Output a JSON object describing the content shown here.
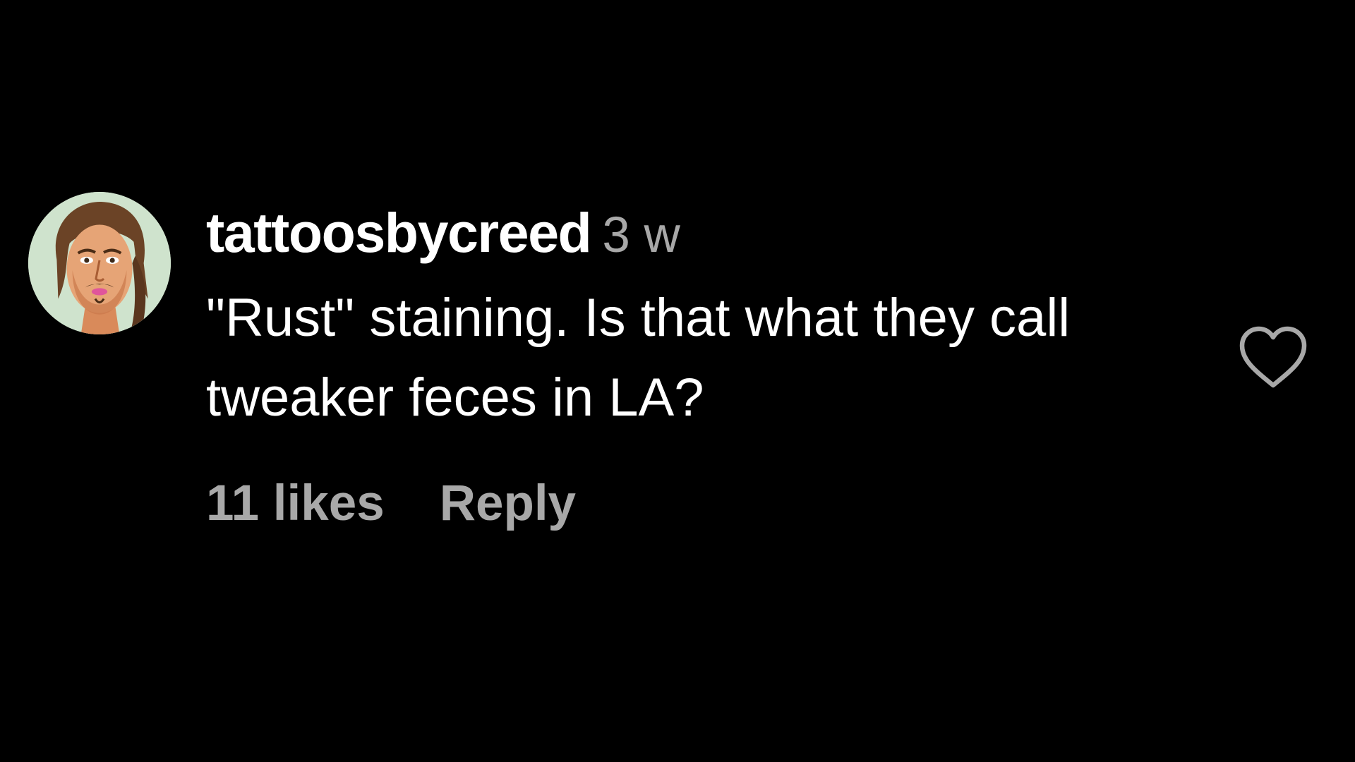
{
  "comment": {
    "username": "tattoosbycreed",
    "timestamp": "3 w",
    "text": "\"Rust\" staining. Is that what they call tweaker feces in LA?",
    "likes": "11 likes",
    "reply_label": "Reply"
  },
  "icons": {
    "like": "heart-outline-icon",
    "avatar": "profile-avatar"
  },
  "colors": {
    "background": "#000000",
    "primary_text": "#ffffff",
    "secondary_text": "#a8a8a8"
  }
}
